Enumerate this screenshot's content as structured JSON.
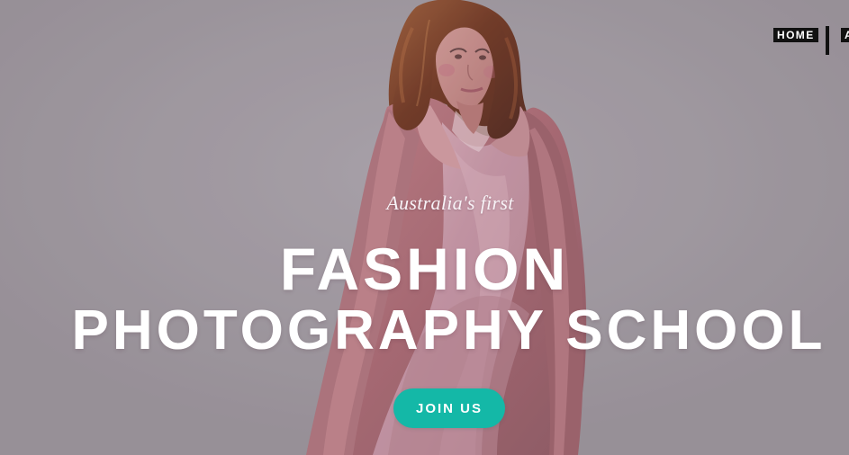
{
  "navigation": {
    "items": [
      {
        "label": "HOME"
      },
      {
        "label": "A"
      }
    ]
  },
  "hero": {
    "eyebrow": "Australia's first",
    "title_line_1": "FASHION",
    "title_line_2": "PHOTOGRAPHY SCHOOL",
    "cta_label": "JOIN US",
    "image_description": "fashion model in pink trench coat and satin dress",
    "colors": {
      "background": "#a29da3",
      "cta": "#14b8a7",
      "title": "#ffffff"
    }
  }
}
